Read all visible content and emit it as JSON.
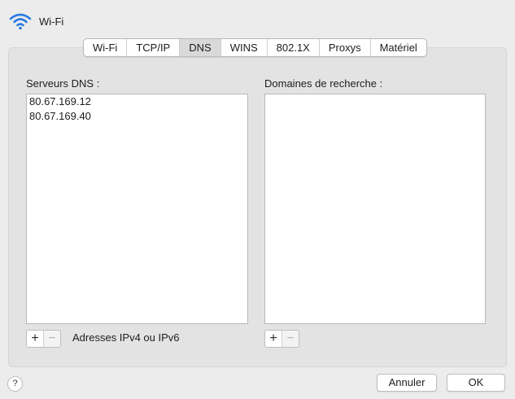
{
  "header": {
    "title": "Wi-Fi",
    "icon": "wifi-icon",
    "accent": "#2a7ae2"
  },
  "tabs": [
    {
      "label": "Wi-Fi"
    },
    {
      "label": "TCP/IP"
    },
    {
      "label": "DNS",
      "active": true
    },
    {
      "label": "WINS"
    },
    {
      "label": "802.1X"
    },
    {
      "label": "Proxys"
    },
    {
      "label": "Matériel"
    }
  ],
  "dns": {
    "label": "Serveurs DNS :",
    "servers": [
      "80.67.169.12",
      "80.67.169.40"
    ],
    "add": "+",
    "remove": "−",
    "hint": "Adresses IPv4 ou IPv6"
  },
  "search_domains": {
    "label": "Domaines de recherche :",
    "add": "+",
    "remove": "−"
  },
  "footer": {
    "help": "?",
    "cancel": "Annuler",
    "ok": "OK"
  }
}
